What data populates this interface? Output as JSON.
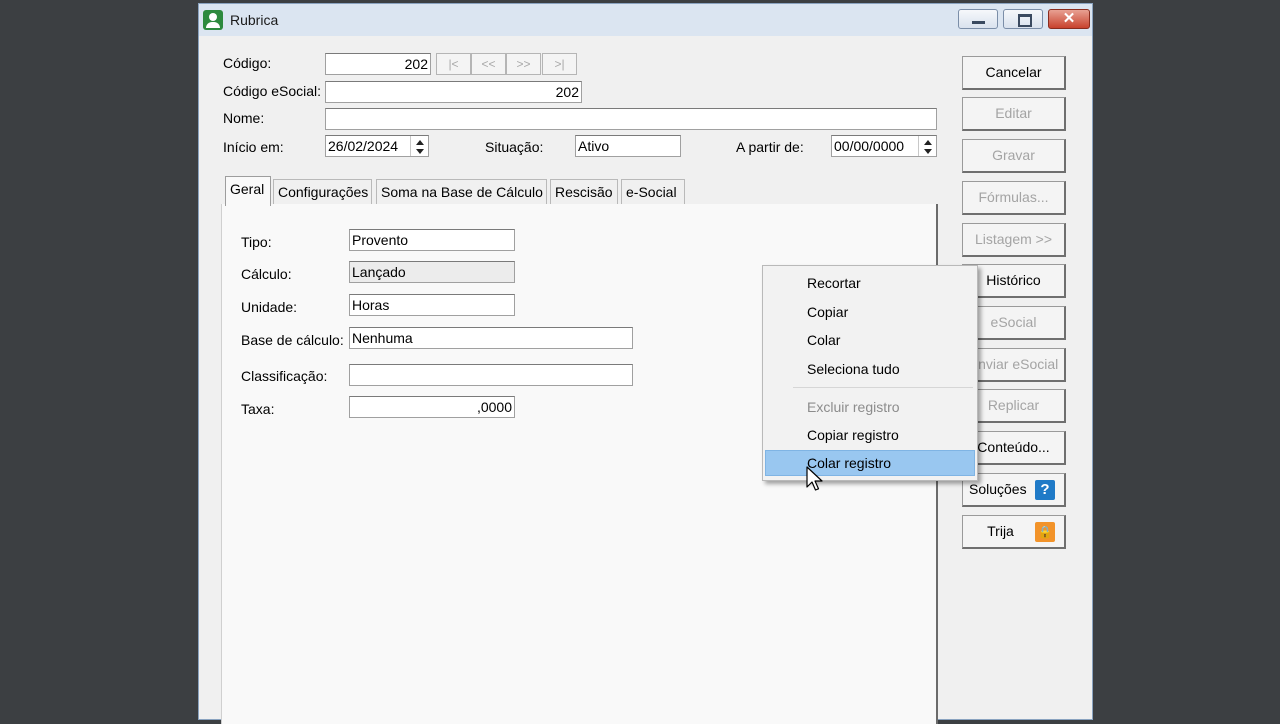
{
  "window": {
    "title": "Rubrica",
    "buttons": {
      "minimize": "minimize",
      "maximize": "maximize",
      "close": "✕"
    }
  },
  "form": {
    "codigo": {
      "label": "Código:",
      "value": "202"
    },
    "nav": {
      "first": "|<",
      "prev": "<<",
      "next": ">>",
      "last": ">|"
    },
    "codigo_esocial": {
      "label": "Código eSocial:",
      "value": "202"
    },
    "nome": {
      "label": "Nome:",
      "value": ""
    },
    "inicio": {
      "label": "Início em:",
      "value": "26/02/2024"
    },
    "situacao": {
      "label": "Situação:",
      "value": "Ativo"
    },
    "a_partir": {
      "label": "A partir de:",
      "value": "00/00/0000"
    }
  },
  "tabs": [
    {
      "label": "Geral",
      "active": true
    },
    {
      "label": "Configurações"
    },
    {
      "label": "Soma na Base de Cálculo"
    },
    {
      "label": "Rescisão"
    },
    {
      "label": "e-Social"
    }
  ],
  "geral": {
    "tipo": {
      "label": "Tipo:",
      "value": "Provento"
    },
    "calculo": {
      "label": "Cálculo:",
      "value": "Lançado"
    },
    "unidade": {
      "label": "Unidade:",
      "value": "Horas"
    },
    "base": {
      "label": "Base de cálculo:",
      "value": "Nenhuma"
    },
    "classificacao": {
      "label": "Classificação:",
      "value": ""
    },
    "taxa": {
      "label": "Taxa:",
      "value": ",0000"
    }
  },
  "side_buttons": {
    "cancelar": "Cancelar",
    "editar": "Editar",
    "gravar": "Gravar",
    "formulas": "Fórmulas...",
    "listagem": "Listagem >>",
    "historico": "Histórico",
    "esocial": "eSocial",
    "enviar_esocial": "Enviar eSocial",
    "replicar": "Replicar",
    "conteudo": "Conteúdo...",
    "solucoes": "Soluções",
    "trija": "Trija",
    "solucoes_icon": "?",
    "trija_icon": "🔒"
  },
  "context_menu": {
    "recortar": "Recortar",
    "copiar": "Copiar",
    "colar": "Colar",
    "seleciona_tudo": "Seleciona tudo",
    "excluir_registro": "Excluir registro",
    "copiar_registro": "Copiar registro",
    "colar_registro": "Colar registro"
  },
  "colors": {
    "accent_highlight": "#99c7f0",
    "titlebar": "#dbe5f1",
    "help_icon": "#1f7ac7",
    "lock_icon": "#f2932a"
  }
}
